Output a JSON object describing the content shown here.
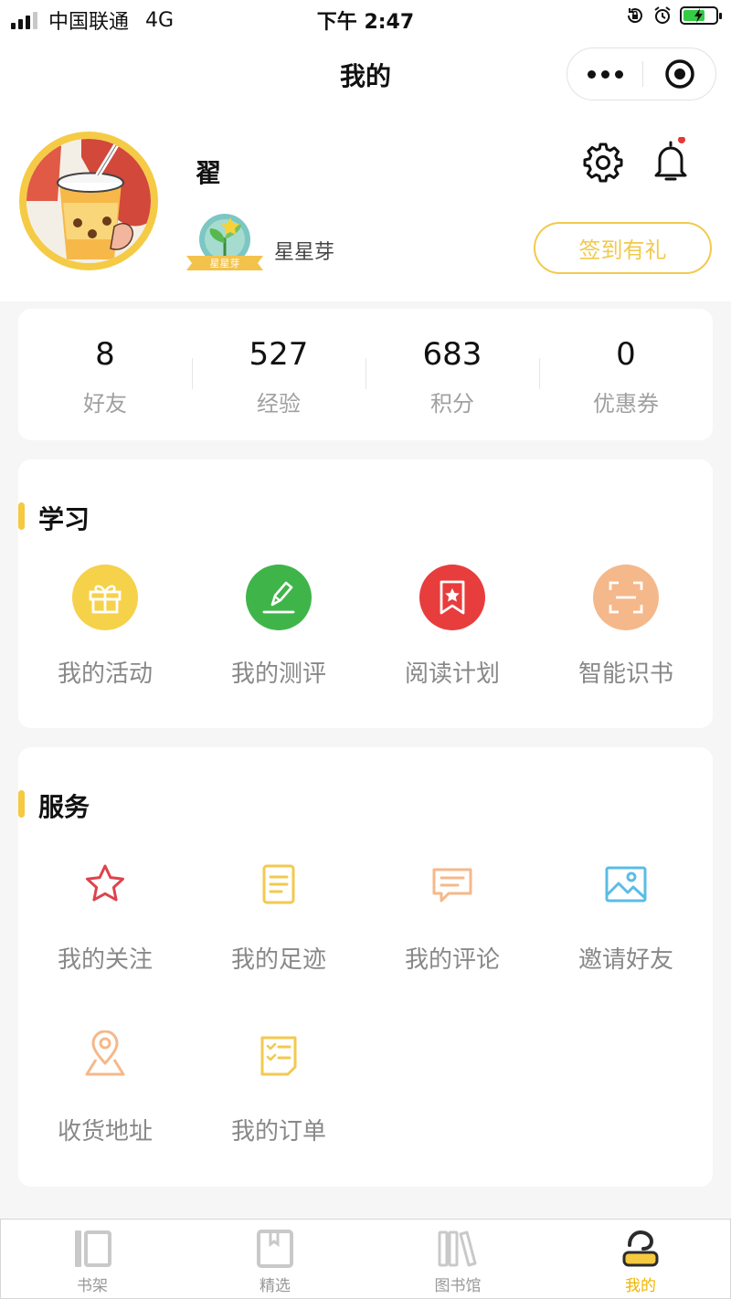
{
  "status_bar": {
    "carrier": "中国联通",
    "network": "4G",
    "time": "下午 2:47"
  },
  "nav": {
    "title": "我的"
  },
  "profile": {
    "username": "翟",
    "badge_text": "星星芽",
    "level_name": "星星芽",
    "signin_label": "签到有礼"
  },
  "stats": [
    {
      "value": "8",
      "label": "好友"
    },
    {
      "value": "527",
      "label": "经验"
    },
    {
      "value": "683",
      "label": "积分"
    },
    {
      "value": "0",
      "label": "优惠券"
    }
  ],
  "study": {
    "title": "学习",
    "items": [
      {
        "label": "我的活动",
        "icon": "gift-icon",
        "color": "#f6d14a"
      },
      {
        "label": "我的测评",
        "icon": "pencil-icon",
        "color": "#3fb549"
      },
      {
        "label": "阅读计划",
        "icon": "bookmark-star-icon",
        "color": "#e83d3d"
      },
      {
        "label": "智能识书",
        "icon": "scan-icon",
        "color": "#f5b88a"
      }
    ]
  },
  "service": {
    "title": "服务",
    "items": [
      {
        "label": "我的关注",
        "icon": "star-icon",
        "color": "#e0424b"
      },
      {
        "label": "我的足迹",
        "icon": "document-icon",
        "color": "#f3c94e"
      },
      {
        "label": "我的评论",
        "icon": "comment-icon",
        "color": "#f5b88a"
      },
      {
        "label": "邀请好友",
        "icon": "image-icon",
        "color": "#5bbce6"
      },
      {
        "label": "收货地址",
        "icon": "location-icon",
        "color": "#f5b88a"
      },
      {
        "label": "我的订单",
        "icon": "order-list-icon",
        "color": "#f3c94e"
      }
    ]
  },
  "tabbar": [
    {
      "label": "书架",
      "icon": "bookshelf-icon",
      "active": false
    },
    {
      "label": "精选",
      "icon": "book-icon",
      "active": false
    },
    {
      "label": "图书馆",
      "icon": "library-icon",
      "active": false
    },
    {
      "label": "我的",
      "icon": "profile-icon",
      "active": true
    }
  ],
  "colors": {
    "accent": "#f5c940",
    "notification_dot": "#e53935"
  }
}
